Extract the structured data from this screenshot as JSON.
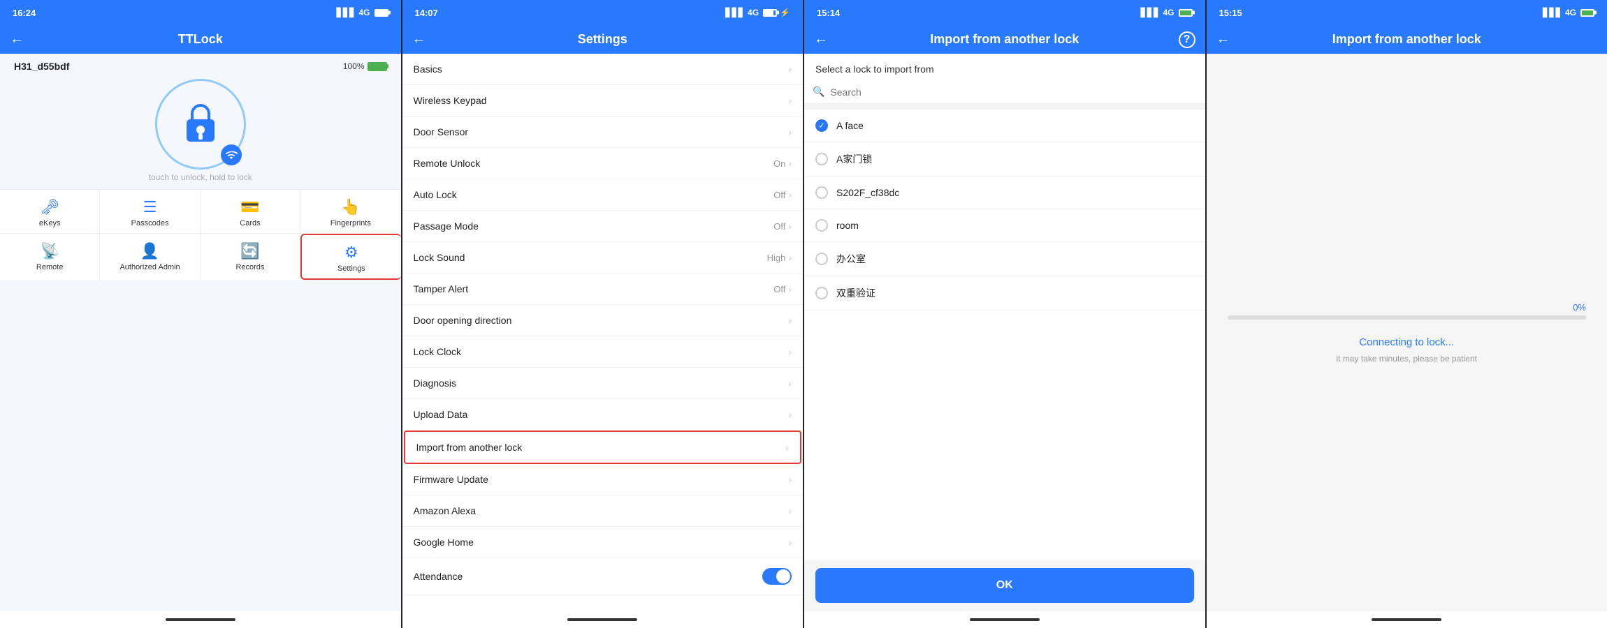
{
  "screen1": {
    "status": {
      "time": "16:24",
      "signal": "4G",
      "battery": 100
    },
    "header": {
      "title": "TTLock"
    },
    "lock": {
      "name": "H31_d55bdf",
      "battery_pct": "100%",
      "touch_hint": "touch to unlock, hold to lock"
    },
    "nav_row1": [
      {
        "id": "ekeys",
        "label": "eKeys",
        "icon": "🗝"
      },
      {
        "id": "passcodes",
        "label": "Passcodes",
        "icon": "☰"
      },
      {
        "id": "cards",
        "label": "Cards",
        "icon": "💳"
      },
      {
        "id": "fingerprints",
        "label": "Fingerprints",
        "icon": "👆"
      }
    ],
    "nav_row2": [
      {
        "id": "remote",
        "label": "Remote",
        "icon": "📡"
      },
      {
        "id": "authorized-admin",
        "label": "Authorized Admin",
        "icon": "👤"
      },
      {
        "id": "records",
        "label": "Records",
        "icon": "🔄"
      },
      {
        "id": "settings",
        "label": "Settings",
        "icon": "⚙"
      }
    ]
  },
  "screen2": {
    "status": {
      "time": "14:07",
      "signal": "4G",
      "battery": 80
    },
    "header": {
      "title": "Settings"
    },
    "items": [
      {
        "id": "basics",
        "label": "Basics",
        "value": "",
        "has_toggle": false
      },
      {
        "id": "wireless-keypad",
        "label": "Wireless Keypad",
        "value": "",
        "has_toggle": false
      },
      {
        "id": "door-sensor",
        "label": "Door Sensor",
        "value": "",
        "has_toggle": false
      },
      {
        "id": "remote-unlock",
        "label": "Remote Unlock",
        "value": "On",
        "has_toggle": false
      },
      {
        "id": "auto-lock",
        "label": "Auto Lock",
        "value": "Off",
        "has_toggle": false
      },
      {
        "id": "passage-mode",
        "label": "Passage Mode",
        "value": "Off",
        "has_toggle": false
      },
      {
        "id": "lock-sound",
        "label": "Lock Sound",
        "value": "High",
        "has_toggle": false
      },
      {
        "id": "tamper-alert",
        "label": "Tamper Alert",
        "value": "Off",
        "has_toggle": false
      },
      {
        "id": "door-opening-direction",
        "label": "Door opening direction",
        "value": "",
        "has_toggle": false
      },
      {
        "id": "lock-clock",
        "label": "Lock Clock",
        "value": "",
        "has_toggle": false
      },
      {
        "id": "diagnosis",
        "label": "Diagnosis",
        "value": "",
        "has_toggle": false
      },
      {
        "id": "upload-data",
        "label": "Upload Data",
        "value": "",
        "has_toggle": false
      },
      {
        "id": "import-from-another-lock",
        "label": "Import from another lock",
        "value": "",
        "has_toggle": false,
        "highlight": true
      },
      {
        "id": "firmware-update",
        "label": "Firmware Update",
        "value": "",
        "has_toggle": false
      },
      {
        "id": "amazon-alexa",
        "label": "Amazon Alexa",
        "value": "",
        "has_toggle": false
      },
      {
        "id": "google-home",
        "label": "Google Home",
        "value": "",
        "has_toggle": false
      },
      {
        "id": "attendance",
        "label": "Attendance",
        "value": "",
        "has_toggle": true,
        "toggle_on": true
      }
    ]
  },
  "screen3": {
    "status": {
      "time": "15:14",
      "signal": "4G",
      "battery": 100
    },
    "header": {
      "title": "Import from another lock"
    },
    "subtitle": "Select a lock to import from",
    "search_placeholder": "Search",
    "locks": [
      {
        "id": "a-face",
        "label": "A face",
        "checked": true
      },
      {
        "id": "a-home-lock",
        "label": "A家门锁",
        "checked": false
      },
      {
        "id": "s202f",
        "label": "S202F_cf38dc",
        "checked": false
      },
      {
        "id": "room",
        "label": "room",
        "checked": false
      },
      {
        "id": "office",
        "label": "办公室",
        "checked": false
      },
      {
        "id": "dual-auth",
        "label": "双重验证",
        "checked": false
      }
    ],
    "ok_button": "OK"
  },
  "screen4": {
    "status": {
      "time": "15:15",
      "signal": "4G",
      "battery": 100
    },
    "header": {
      "title": "Import from another lock"
    },
    "progress_pct": "0%",
    "progress_value": 0,
    "connecting_text": "Connecting to lock...",
    "connecting_sub": "it may take minutes, please be patient"
  }
}
